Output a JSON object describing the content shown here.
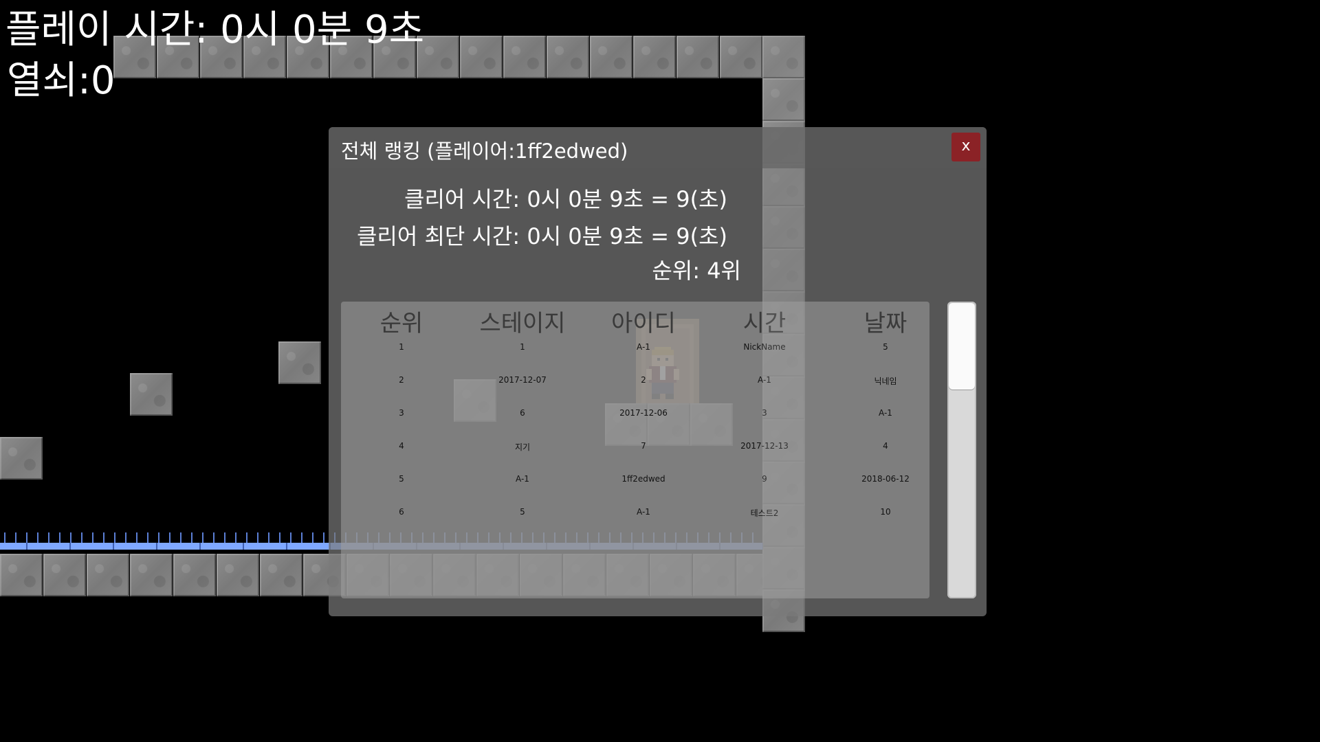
{
  "hud": {
    "play_time": "플레이 시간: 0시 0분 9초",
    "keys": "열쇠:0"
  },
  "ranking_dialog": {
    "title": "전체 랭킹 (플레이어:1ff2edwed)",
    "close_label": "x",
    "clear_time": "클리어 시간: 0시 0분 9초 = 9(초)",
    "best_time": "클리어 최단 시간: 0시 0분 9초 = 9(초)",
    "rank": "순위: 4위",
    "table": {
      "headers": [
        "순위",
        "스테이지",
        "아이디",
        "시간",
        "날짜"
      ],
      "rows": [
        [
          "1",
          "1",
          "A-1",
          "NickName",
          "5"
        ],
        [
          "2",
          "2017-12-07",
          "2",
          "A-1",
          "닉네임"
        ],
        [
          "3",
          "6",
          "2017-12-06",
          "3",
          "A-1"
        ],
        [
          "4",
          "지기",
          "7",
          "2017-12-13",
          "4"
        ],
        [
          "5",
          "A-1",
          "1ff2edwed",
          "9",
          "2018-06-12"
        ],
        [
          "6",
          "5",
          "A-1",
          "테스트2",
          "10"
        ]
      ]
    }
  },
  "colors": {
    "background": "#000000",
    "tile": "#858585",
    "spike_rail": "#7fa8ff",
    "close_button": "#8b2226",
    "panel": "#7a7a7a"
  },
  "icons": [
    "stone-tile",
    "spike-strip",
    "door-icon",
    "player-sprite-icon",
    "close-icon"
  ]
}
